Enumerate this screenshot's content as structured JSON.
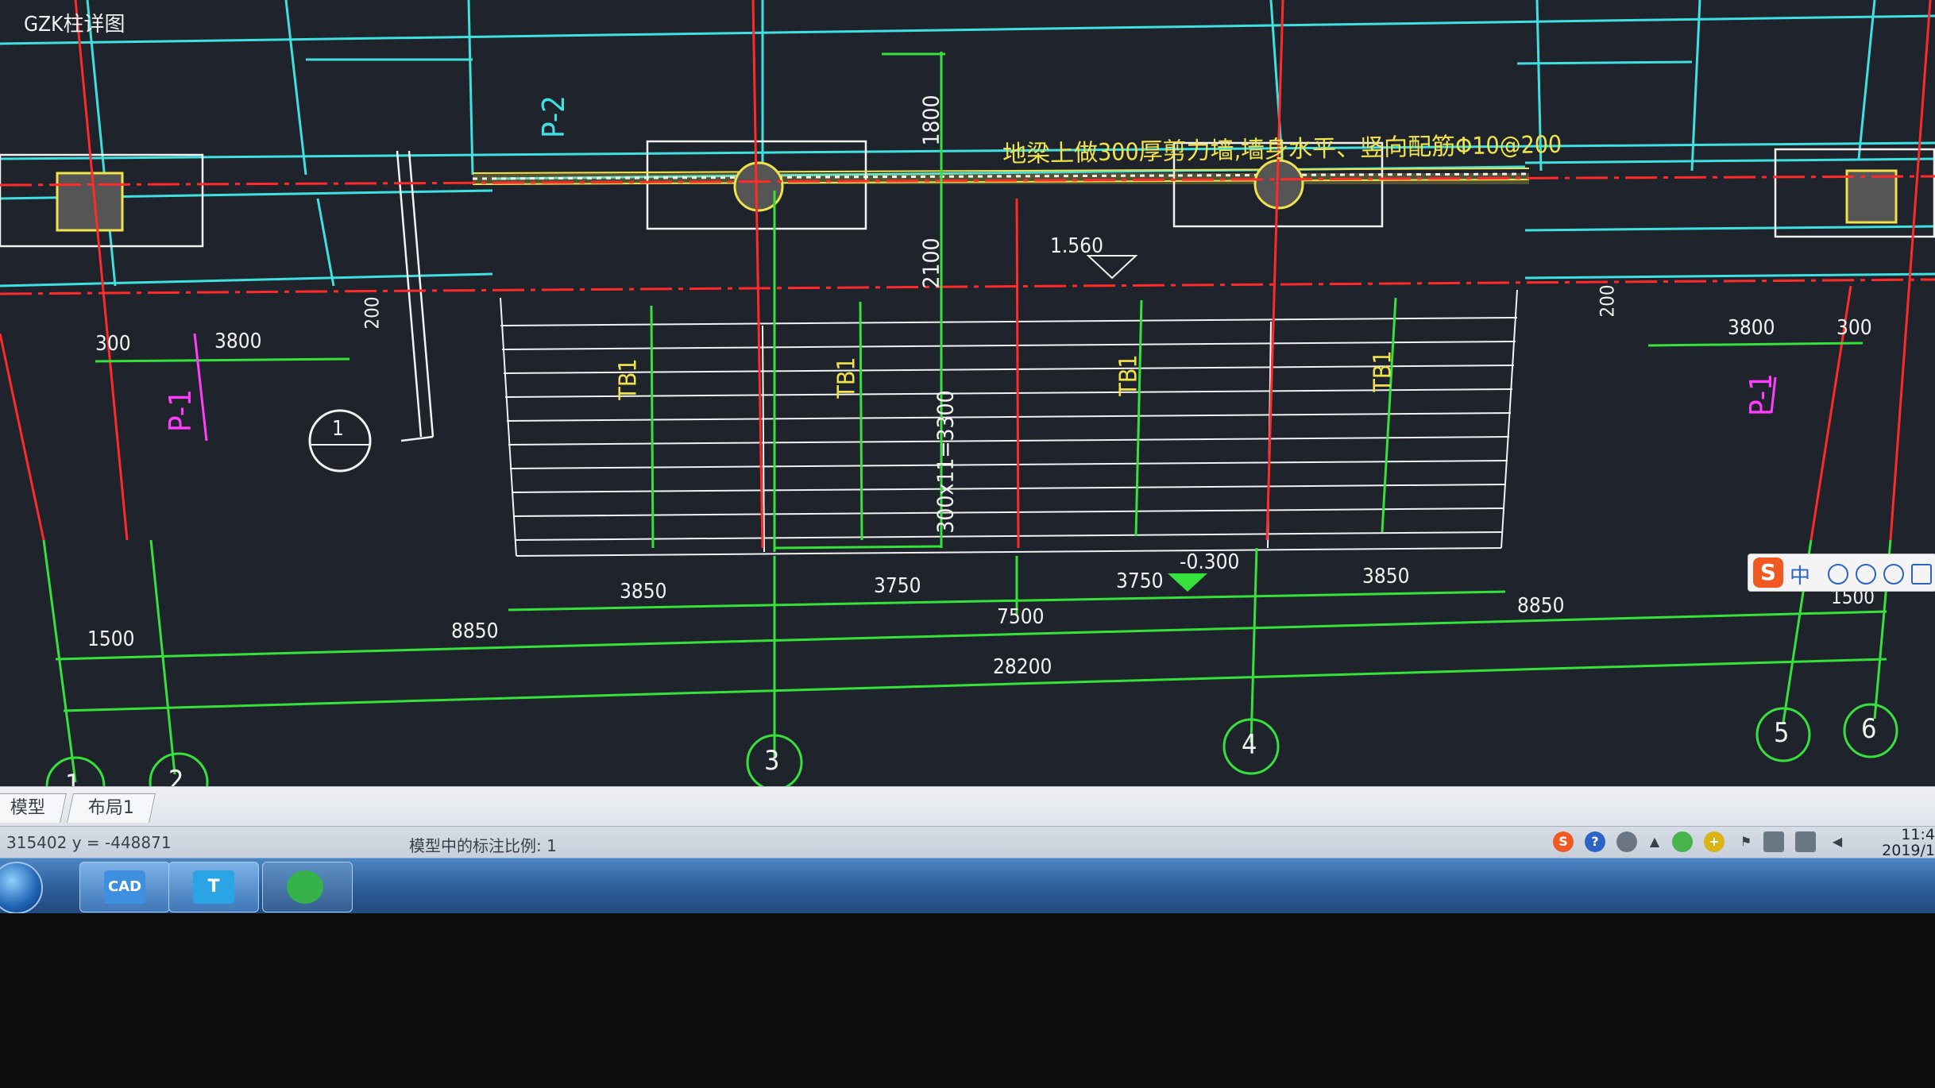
{
  "drawing": {
    "title_fragment": "GZK柱详图",
    "wall_note": "地梁上做300厚剪力墙,墙身水平、竖向配筋Φ10@200",
    "panel_labels": [
      "P-2",
      "P-1",
      "P-1"
    ],
    "stair_labels": [
      "TB1",
      "TB1",
      "TB1",
      "TB1"
    ],
    "stair_spec": "300x11=3300",
    "level_upper": "1.560",
    "level_lower": "-0.300",
    "section_mark": "1",
    "vertical_dims": [
      "1800",
      "2100",
      "200",
      "200"
    ],
    "small_dims": [
      "300",
      "3800",
      "3800",
      "300"
    ],
    "bay_dims": [
      "3850",
      "3750",
      "3750",
      "3850"
    ],
    "group_dims": [
      "1500",
      "8850",
      "7500",
      "8850",
      "1500"
    ],
    "total_dim": "28200",
    "grid_axes": [
      "1",
      "2",
      "3",
      "4",
      "5",
      "6"
    ]
  },
  "tabs": {
    "model": "模型",
    "layout1": "布局1"
  },
  "status": {
    "coords": "315402  y = -448871",
    "annotation_scale": "模型中的标注比例: 1"
  },
  "tray": {
    "time": "11:4",
    "date": "2019/1"
  },
  "taskbar": {
    "apps": [
      {
        "name": "CAD",
        "color": "#3f8fe0"
      },
      {
        "name": "T",
        "color": "#2aa4e4"
      },
      {
        "name": "",
        "color": "#35b34a"
      }
    ]
  },
  "ime": {
    "logo": "S",
    "mode": "中"
  },
  "colors": {
    "background": "#1f232b",
    "grid_red": "#ff2b2b",
    "cyan": "#3fe0e0",
    "green": "#35e13a",
    "yellow": "#f0e24a",
    "magenta": "#ff3cff",
    "white": "#f2f2f2"
  }
}
